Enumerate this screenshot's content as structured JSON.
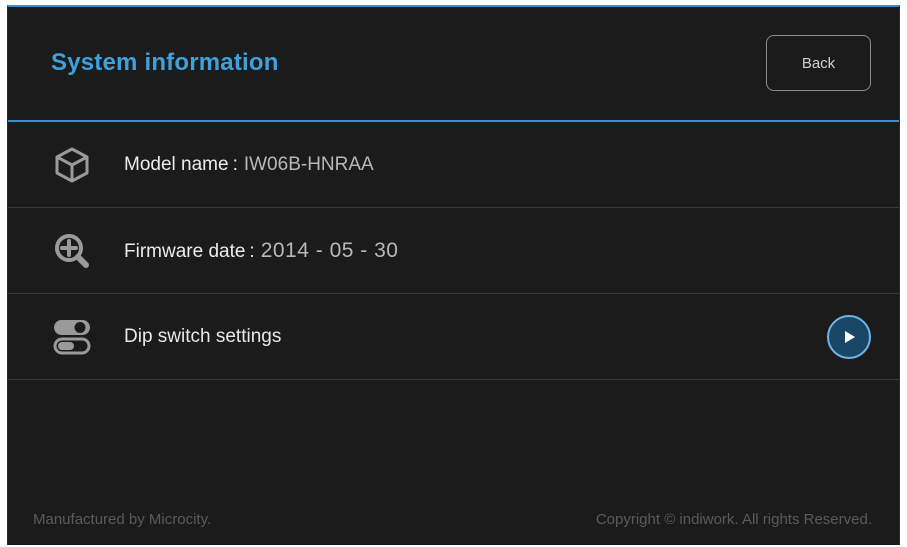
{
  "header": {
    "title": "System information",
    "back_label": "Back"
  },
  "rows": [
    {
      "icon": "cube-icon",
      "label": "Model name",
      "separator": ":",
      "value": "IW06B-HNRAA"
    },
    {
      "icon": "zoom-in-icon",
      "label": "Firmware date",
      "separator": ":",
      "value": "2014 - 05 - 30"
    },
    {
      "icon": "toggle-switch-icon",
      "label": "Dip switch settings",
      "action_icon": "play-icon"
    }
  ],
  "footer": {
    "manufacturer": "Manufactured by Microcity.",
    "copyright": "Copyright © indiwork. All rights Reserved."
  },
  "colors": {
    "background": "#1b1b1b",
    "accent": "#3fa1dc",
    "divider": "#3a8fc9",
    "text": "#ececec",
    "muted": "#5a5a5a"
  }
}
